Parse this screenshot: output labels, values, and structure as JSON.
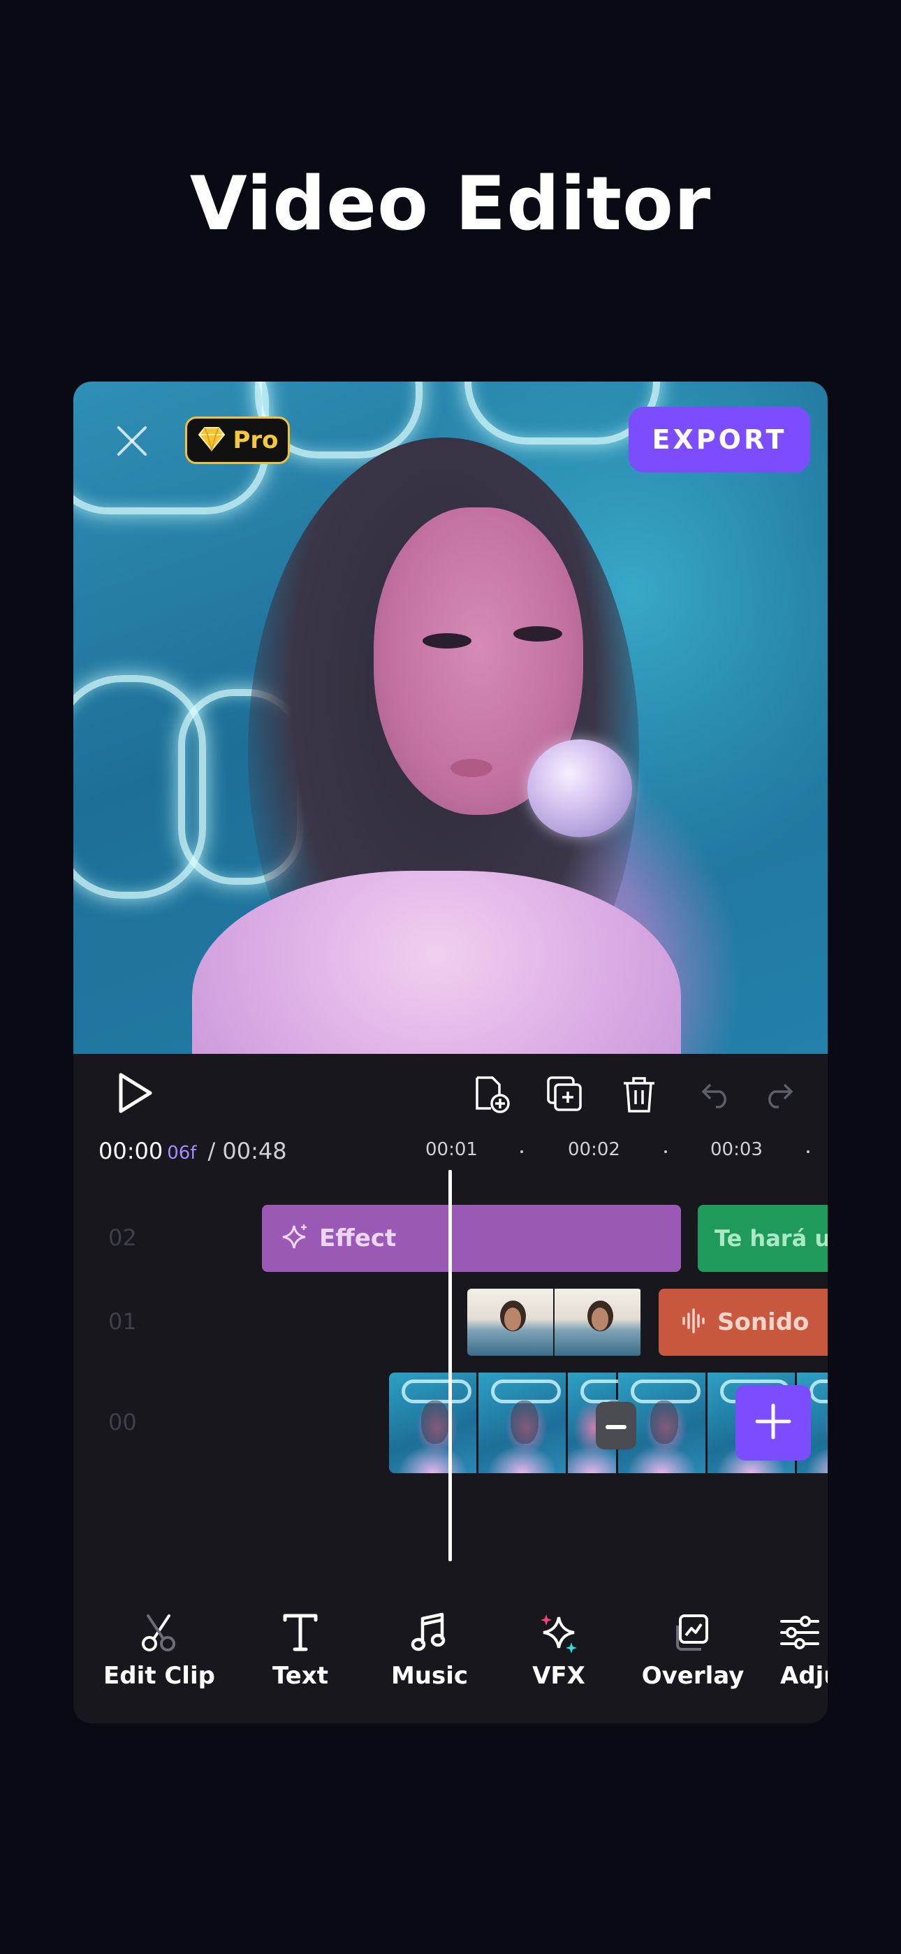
{
  "headline": "Video Editor",
  "preview": {
    "pro_badge": "Pro",
    "export_label": "EXPORT"
  },
  "playback": {
    "current_time": "00:00",
    "current_frame": "06f",
    "total_time": "/ 00:48"
  },
  "ruler": {
    "marks": [
      "00:01",
      "00:02",
      "00:03"
    ]
  },
  "tracks": {
    "row_labels": [
      "02",
      "01",
      "00"
    ],
    "effect_clip_label": "Effect",
    "text_clip_label": "Te hará u",
    "sound_clip_label": "Sonido"
  },
  "toolbar": {
    "items": [
      {
        "label": "Edit Clip",
        "icon": "scissors-icon"
      },
      {
        "label": "Text",
        "icon": "text-icon"
      },
      {
        "label": "Music",
        "icon": "music-note-icon"
      },
      {
        "label": "VFX",
        "icon": "sparkle-icon"
      },
      {
        "label": "Overlay",
        "icon": "overlay-icon"
      },
      {
        "label": "Adju",
        "icon": "sliders-icon"
      }
    ]
  },
  "colors": {
    "background": "#0a0a14",
    "panel": "#17171d",
    "accent": "#7c4dff",
    "pro_gold": "#f1c232",
    "effect_clip": "#9b59b6",
    "text_clip": "#1f9a5a",
    "sound_clip": "#c8573f"
  }
}
